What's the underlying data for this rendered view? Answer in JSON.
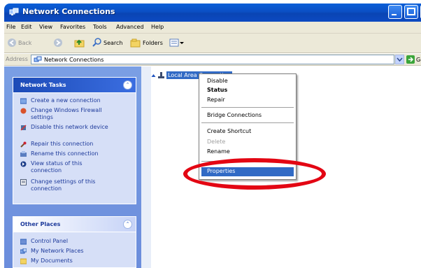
{
  "window": {
    "title": "Network Connections"
  },
  "menu": [
    "File",
    "Edit",
    "View",
    "Favorites",
    "Tools",
    "Advanced",
    "Help"
  ],
  "toolbar": {
    "back": "Back",
    "search": "Search",
    "folders": "Folders"
  },
  "address": {
    "label": "Address",
    "value": "Network Connections",
    "go": "Go"
  },
  "network_tasks": {
    "title": "Network Tasks",
    "items": [
      "Create a new connection",
      "Change Windows Firewall settings",
      "Disable this network device",
      "Repair this connection",
      "Rename this connection",
      "View status of this connection",
      "Change settings of this connection"
    ]
  },
  "other_places": {
    "title": "Other Places",
    "items": [
      "Control Panel",
      "My Network Places",
      "My Documents"
    ]
  },
  "connection": {
    "label": "Local Area Connection"
  },
  "context_menu": {
    "items": [
      "Disable",
      "Status",
      "Repair",
      "Bridge Connections",
      "Create Shortcut",
      "Delete",
      "Rename",
      "Properties"
    ]
  },
  "colors": {
    "highlight": "#316ac5",
    "annotation": "#e30613",
    "titlebar": "#0b4fc4"
  }
}
